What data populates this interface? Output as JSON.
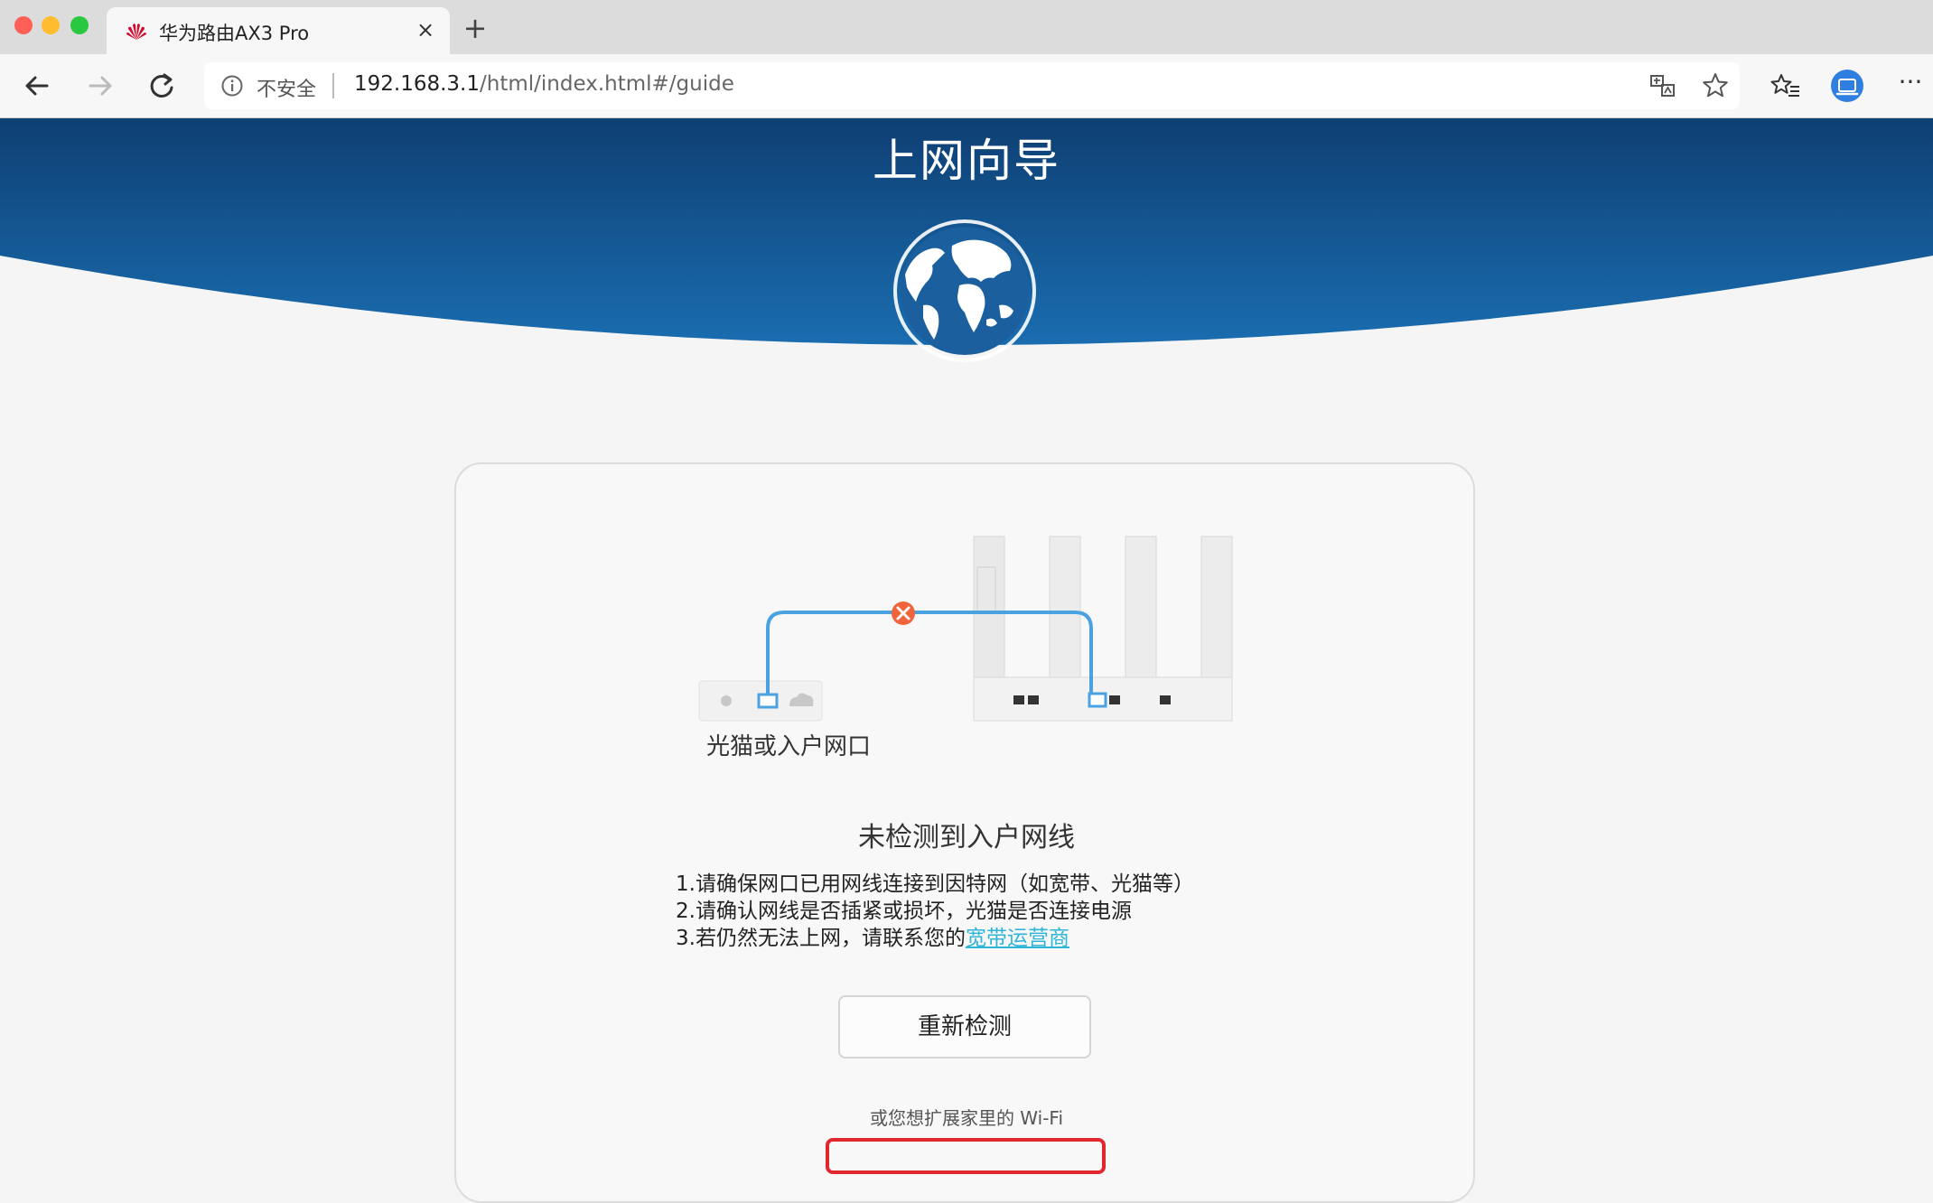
{
  "browser": {
    "tab_title": "华为路由AX3 Pro",
    "tab_close": "×",
    "new_tab": "+",
    "insecure_label": "不安全",
    "url_host": "192.168.3.1",
    "url_path": "/html/index.html#/guide",
    "more_menu": "···"
  },
  "page": {
    "title": "上网向导",
    "modem_label": "光猫或入户网口",
    "status_title": "未检测到入户网线",
    "tips": [
      "1.请确保网口已用网线连接到因特网（如宽带、光猫等）",
      "2.请确认网线是否插紧或损坏，光猫是否连接电源"
    ],
    "tip3_prefix": "3.若仍然无法上网，请联系您的",
    "tip3_link": "宽带运营商",
    "recheck_button": "重新检测",
    "extend_text": "或您想扩展家里的 Wi-Fi"
  },
  "colors": {
    "banner_dark": "#0e3f73",
    "banner_light": "#1a6db0",
    "link": "#2fb5d8",
    "error": "#f0643c",
    "cable": "#4aa3e0",
    "highlight": "#e0282e"
  }
}
